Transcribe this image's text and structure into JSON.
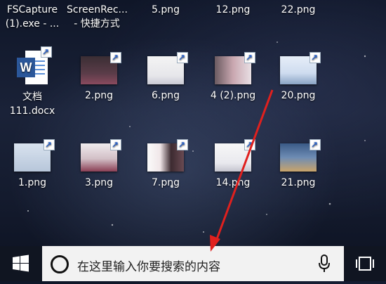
{
  "desktop": {
    "row1": [
      {
        "name": "FSCapture",
        "line1": "FSCapture",
        "line2": "(1).exe - ..."
      },
      {
        "name": "ScreenRec",
        "line1": "ScreenRec...",
        "line2": "- 快捷方式"
      },
      {
        "name": "5png",
        "line1": "5.png",
        "line2": ""
      },
      {
        "name": "12png",
        "line1": "12.png",
        "line2": ""
      },
      {
        "name": "22png",
        "line1": "22.png",
        "line2": ""
      }
    ],
    "row2": [
      {
        "name": "wendang",
        "line1": "文档",
        "line2": "111.docx"
      },
      {
        "name": "2png",
        "line1": "2.png",
        "line2": ""
      },
      {
        "name": "6png",
        "line1": "6.png",
        "line2": ""
      },
      {
        "name": "4-2png",
        "line1": "4 (2).png",
        "line2": ""
      },
      {
        "name": "20png",
        "line1": "20.png",
        "line2": ""
      }
    ],
    "row3": [
      {
        "name": "1png",
        "line1": "1.png",
        "line2": ""
      },
      {
        "name": "3png",
        "line1": "3.png",
        "line2": ""
      },
      {
        "name": "7png",
        "line1": "7.png",
        "line2": ""
      },
      {
        "name": "14png",
        "line1": "14.png",
        "line2": ""
      },
      {
        "name": "21png",
        "line1": "21.png",
        "line2": ""
      }
    ],
    "word_badge": "W"
  },
  "taskbar": {
    "search_placeholder": "在这里输入你要搜索的内容"
  },
  "colors": {
    "taskbar_bg": "#101521",
    "search_bg": "#f2f2f2",
    "arrow": "#e0201e",
    "word_blue": "#2b579a"
  }
}
